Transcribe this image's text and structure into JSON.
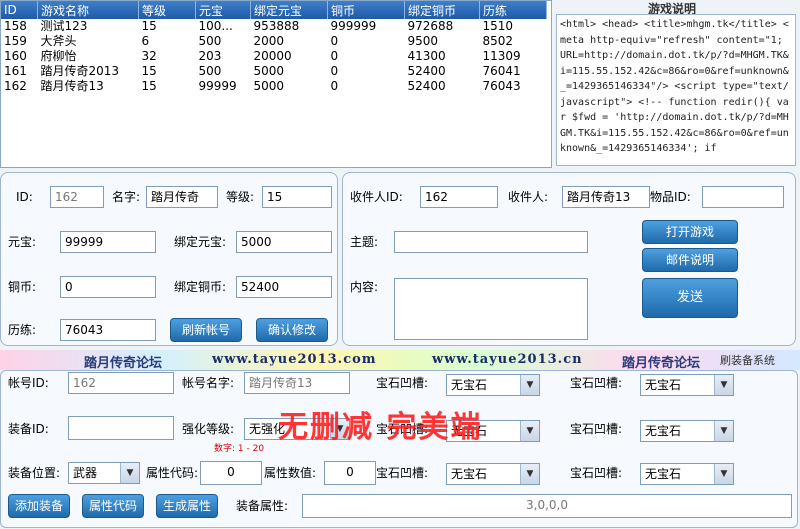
{
  "table": {
    "headers": [
      "ID",
      "游戏名称",
      "等级",
      "元宝",
      "绑定元宝",
      "铜币",
      "绑定铜币",
      "历练"
    ],
    "rows": [
      [
        "158",
        "测试123",
        "15",
        "100...",
        "953888",
        "999999",
        "972688",
        "1510"
      ],
      [
        "159",
        "大斧头",
        "6",
        "500",
        "2000",
        "0",
        "9500",
        "8502"
      ],
      [
        "160",
        "府柳怡",
        "32",
        "203",
        "20000",
        "0",
        "41300",
        "11309"
      ],
      [
        "161",
        "踏月传奇2013",
        "15",
        "500",
        "5000",
        "0",
        "52400",
        "76041"
      ],
      [
        "162",
        "踏月传奇13",
        "15",
        "99999",
        "5000",
        "0",
        "52400",
        "76043"
      ]
    ]
  },
  "description": {
    "title": "游戏说明",
    "text": "<html>    <head>    <title>mhgm.tk</title>    <meta http-equiv=\"refresh\" content=\"1; URL=http://domain.dot.tk/p/?d=MHGM.TK&i=115.55.152.42&c=86&ro=0&ref=unknown&_=1429365146334\"/>    <script type=\"text/javascript\">    <!--      function redir(){ var $fwd = 'http://domain.dot.tk/p/?d=MHGM.TK&i=115.55.152.42&c=86&ro=0&ref=unknown&_=1429365146334'; if"
  },
  "character": {
    "id_label": "ID:",
    "id_value": "162",
    "name_label": "名字:",
    "name_value": "踏月传奇",
    "level_label": "等级:",
    "level_value": "15",
    "yuanbao_label": "元宝:",
    "yuanbao_value": "99999",
    "bind_yuanbao_label": "绑定元宝:",
    "bind_yuanbao_value": "5000",
    "copper_label": "铜币:",
    "copper_value": "0",
    "bind_copper_label": "绑定铜币:",
    "bind_copper_value": "52400",
    "exp_label": "历练:",
    "exp_value": "76043",
    "refresh_button": "刷新帐号",
    "confirm_button": "确认修改"
  },
  "mail": {
    "recipient_id_label": "收件人ID:",
    "recipient_id_value": "162",
    "recipient_label": "收件人:",
    "recipient_value": "踏月传奇13",
    "item_id_label": "物品ID:",
    "item_id_value": "",
    "subject_label": "主题:",
    "subject_value": "",
    "content_label": "内容:",
    "content_value": "",
    "open_game_button": "打开游戏",
    "mail_help_button": "邮件说明",
    "send_button": "发送"
  },
  "banner": {
    "forum1": "踏月传奇论坛",
    "url1": "www.tayue2013.com",
    "url2": "www.tayue2013.cn",
    "forum2": "踏月传奇论坛",
    "system_label": "刷装备系统"
  },
  "equipment": {
    "account_id_label": "帐号ID:",
    "account_id_value": "162",
    "account_name_label": "帐号名字:",
    "account_name_value": "踏月传奇13",
    "equip_id_label": "装备ID:",
    "equip_id_value": "",
    "enhance_label": "强化等级:",
    "enhance_value": "无强化",
    "enhance_hint": "数字: 1 - 20",
    "position_label": "装备位置:",
    "position_value": "武器",
    "attr_code_label": "属性代码:",
    "attr_code_value": "0",
    "attr_value_label": "属性数值:",
    "attr_value_value": "0",
    "gem_label": "宝石凹槽:",
    "gem_value": "无宝石",
    "add_button": "添加装备",
    "attr_code_button": "属性代码",
    "gen_attr_button": "生成属性",
    "attr_field_label": "装备属性:",
    "attr_field_value": "3,0,0,0"
  },
  "watermark": "无删减 完美端"
}
